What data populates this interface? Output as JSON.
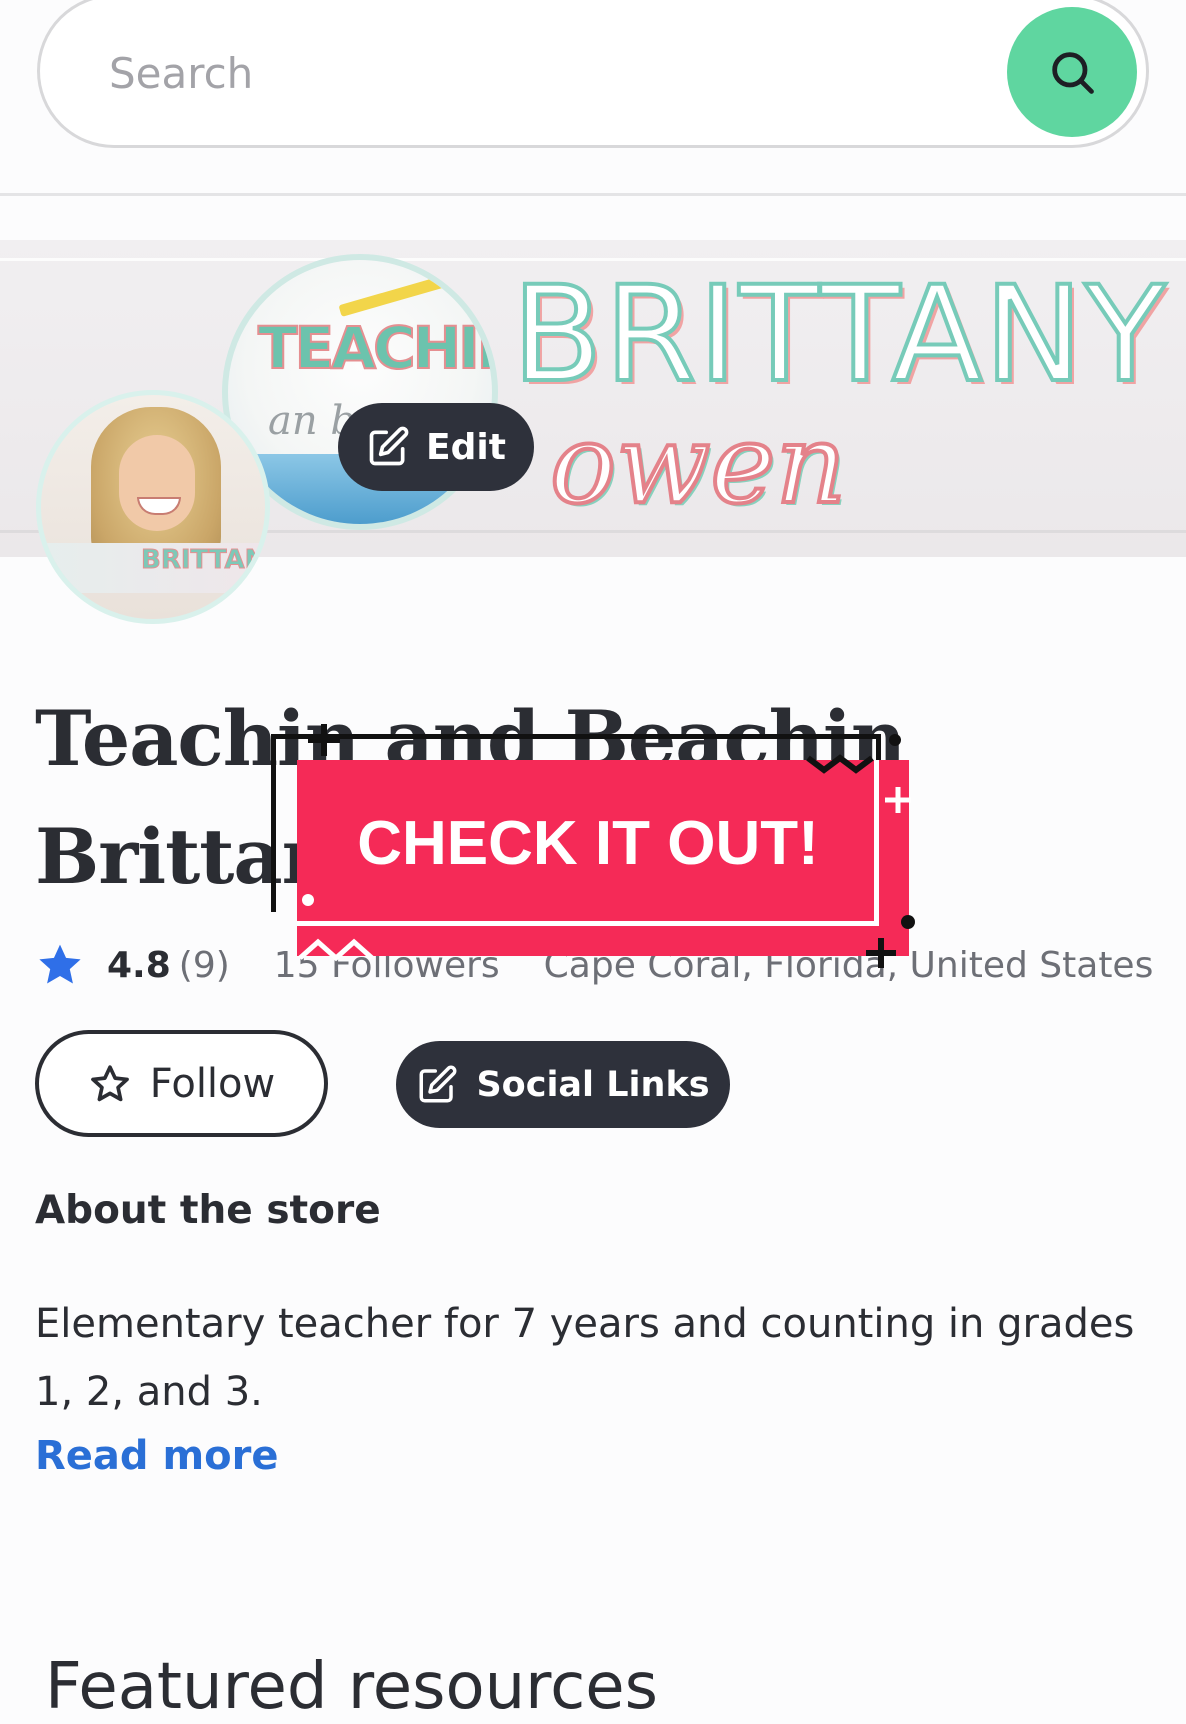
{
  "search": {
    "placeholder": "Search"
  },
  "banner": {
    "brand_first": "BRITTANY",
    "brand_last": "owen",
    "circle_text": "TEACHIN",
    "circle_sub": "an be",
    "edit_label": "Edit",
    "avatar_badge": "BRITTANY"
  },
  "store": {
    "title": "Teachin and Beachin Brittany",
    "rating": "4.8",
    "rating_count": "(9)",
    "followers": "15 Followers",
    "location": "Cape Coral, Florida, United States"
  },
  "actions": {
    "follow_label": "Follow",
    "social_label": "Social Links"
  },
  "about": {
    "heading": "About the store",
    "text": "Elementary teacher for 7 years and counting in grades 1, 2, and 3.",
    "read_more": "Read more"
  },
  "featured": {
    "heading": "Featured resources"
  },
  "overlay": {
    "sticker_text": "CHECK IT OUT!"
  },
  "colors": {
    "search_button": "#5fd6a0",
    "dark_button": "#2e313b",
    "link": "#2a6fd6",
    "star": "#2f6fe8",
    "sticker": "#f52a57"
  },
  "icons": {
    "search": "search-icon",
    "edit": "edit-icon",
    "star_filled": "star-icon",
    "star_outline": "star-outline-icon"
  }
}
